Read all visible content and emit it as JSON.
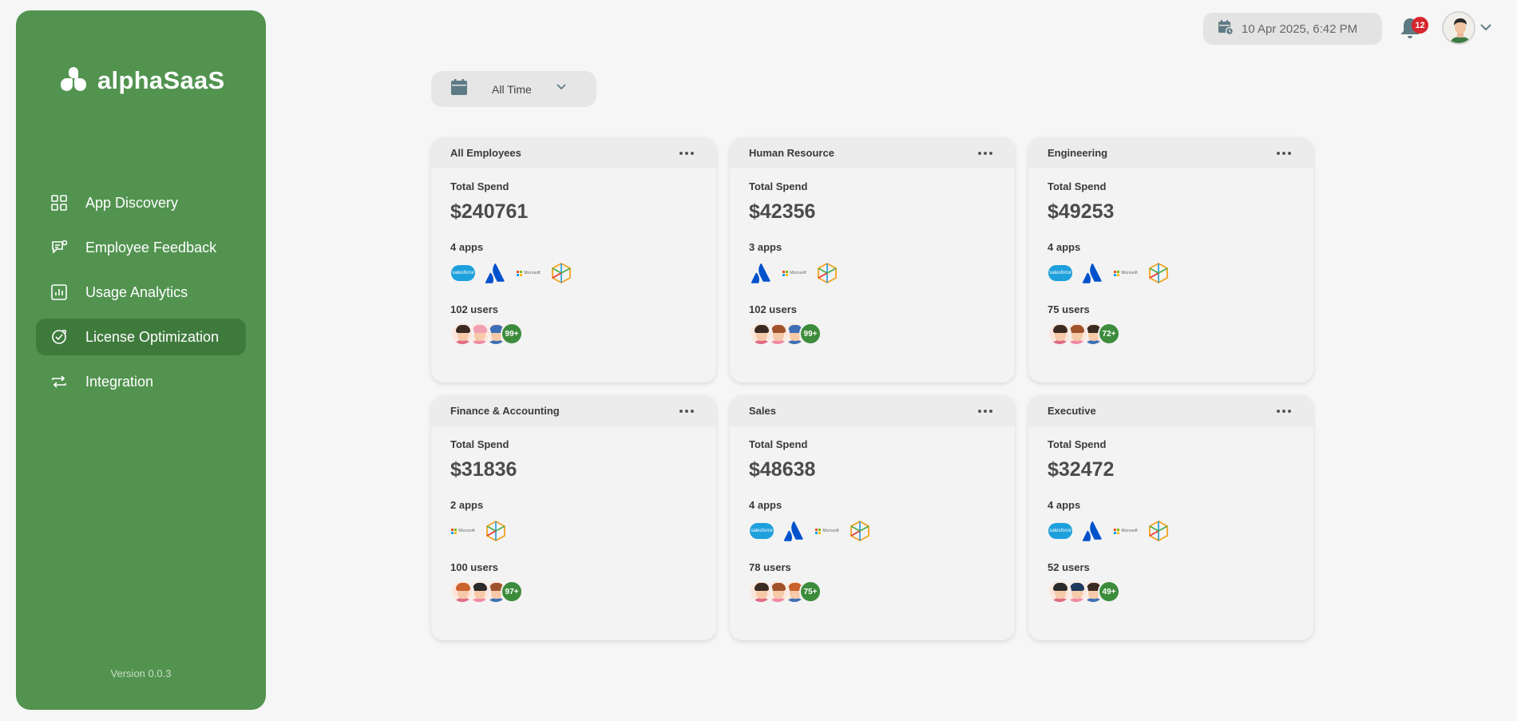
{
  "sidebar": {
    "brand": "alphaSaaS",
    "items": [
      {
        "label": "App Discovery",
        "icon": "grid-icon",
        "active": false
      },
      {
        "label": "Employee Feedback",
        "icon": "feedback-icon",
        "active": false
      },
      {
        "label": "Usage Analytics",
        "icon": "chart-icon",
        "active": false
      },
      {
        "label": "License Optimization",
        "icon": "badge-check-icon",
        "active": true
      },
      {
        "label": "Integration",
        "icon": "sync-icon",
        "active": false
      }
    ],
    "version": "Version 0.0.3"
  },
  "header": {
    "datetime": "10 Apr 2025, 6:42 PM",
    "notification_count": "12"
  },
  "filter": {
    "label": "All Time"
  },
  "cards": [
    {
      "title": "All Employees",
      "spend_label": "Total Spend",
      "spend": "$240761",
      "apps_label": "4 apps",
      "apps": [
        "salesforce",
        "atlassian",
        "microsoft",
        "cube"
      ],
      "users_label": "102 users",
      "more": "99+"
    },
    {
      "title": "Human Resource",
      "spend_label": "Total Spend",
      "spend": "$42356",
      "apps_label": "3 apps",
      "apps": [
        "atlassian",
        "microsoft",
        "cube"
      ],
      "users_label": "102 users",
      "more": "99+"
    },
    {
      "title": "Engineering",
      "spend_label": "Total Spend",
      "spend": "$49253",
      "apps_label": "4 apps",
      "apps": [
        "salesforce",
        "atlassian",
        "microsoft",
        "cube"
      ],
      "users_label": "75 users",
      "more": "72+"
    },
    {
      "title": "Finance & Accounting",
      "spend_label": "Total Spend",
      "spend": "$31836",
      "apps_label": "2 apps",
      "apps": [
        "microsoft",
        "cube"
      ],
      "users_label": "100 users",
      "more": "97+"
    },
    {
      "title": "Sales",
      "spend_label": "Total Spend",
      "spend": "$48638",
      "apps_label": "4 apps",
      "apps": [
        "salesforce",
        "atlassian",
        "microsoft",
        "cube"
      ],
      "users_label": "78 users",
      "more": "75+"
    },
    {
      "title": "Executive",
      "spend_label": "Total Spend",
      "spend": "$32472",
      "apps_label": "4 apps",
      "apps": [
        "salesforce",
        "atlassian",
        "microsoft",
        "cube"
      ],
      "users_label": "52 users",
      "more": "49+"
    }
  ],
  "colors": {
    "sidebar": "#529350",
    "active": "#3f7a3d",
    "count_badge": "#3d8c3c",
    "notification": "#d7262e"
  }
}
